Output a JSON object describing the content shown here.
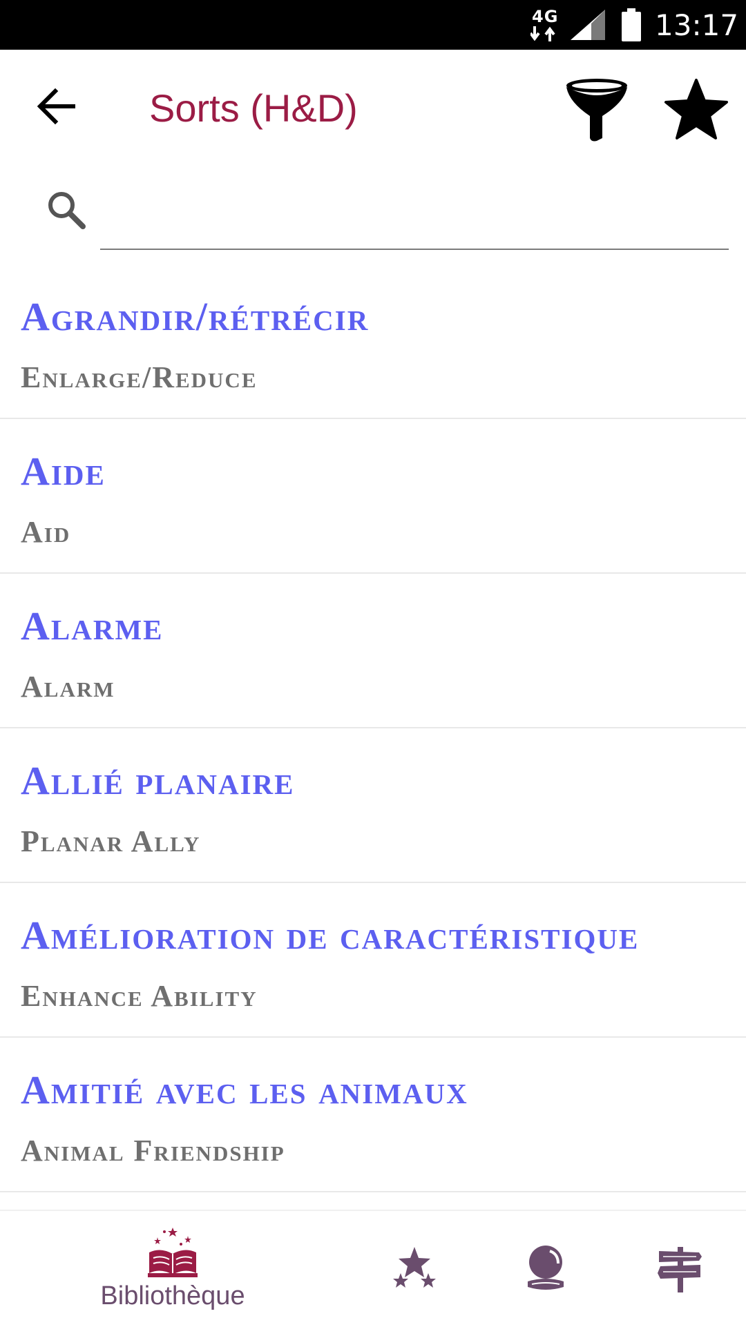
{
  "status_bar": {
    "network": "4G",
    "time": "13:17"
  },
  "app_bar": {
    "title": "Sorts (H&D)"
  },
  "search": {
    "value": "",
    "placeholder": ""
  },
  "spells": [
    {
      "name_fr": "Agrandir/rétrécir",
      "name_en": "Enlarge/Reduce"
    },
    {
      "name_fr": "Aide",
      "name_en": "Aid"
    },
    {
      "name_fr": "Alarme",
      "name_en": "Alarm"
    },
    {
      "name_fr": "Allié planaire",
      "name_en": "Planar Ally"
    },
    {
      "name_fr": "Amélioration de caractéristique",
      "name_en": "Enhance Ability"
    },
    {
      "name_fr": "Amitié avec les animaux",
      "name_en": "Animal Friendship"
    }
  ],
  "bottom_nav": {
    "library_label": "Bibliothèque",
    "icons": [
      "book-icon",
      "stars-icon",
      "crystal-ball-icon",
      "signpost-icon"
    ]
  },
  "colors": {
    "title": "#9b1c45",
    "spell_fr": "#5c5ff0",
    "spell_en": "#6f6f6f",
    "nav_icon": "#6a4d6d",
    "nav_active": "#9b1c45"
  }
}
